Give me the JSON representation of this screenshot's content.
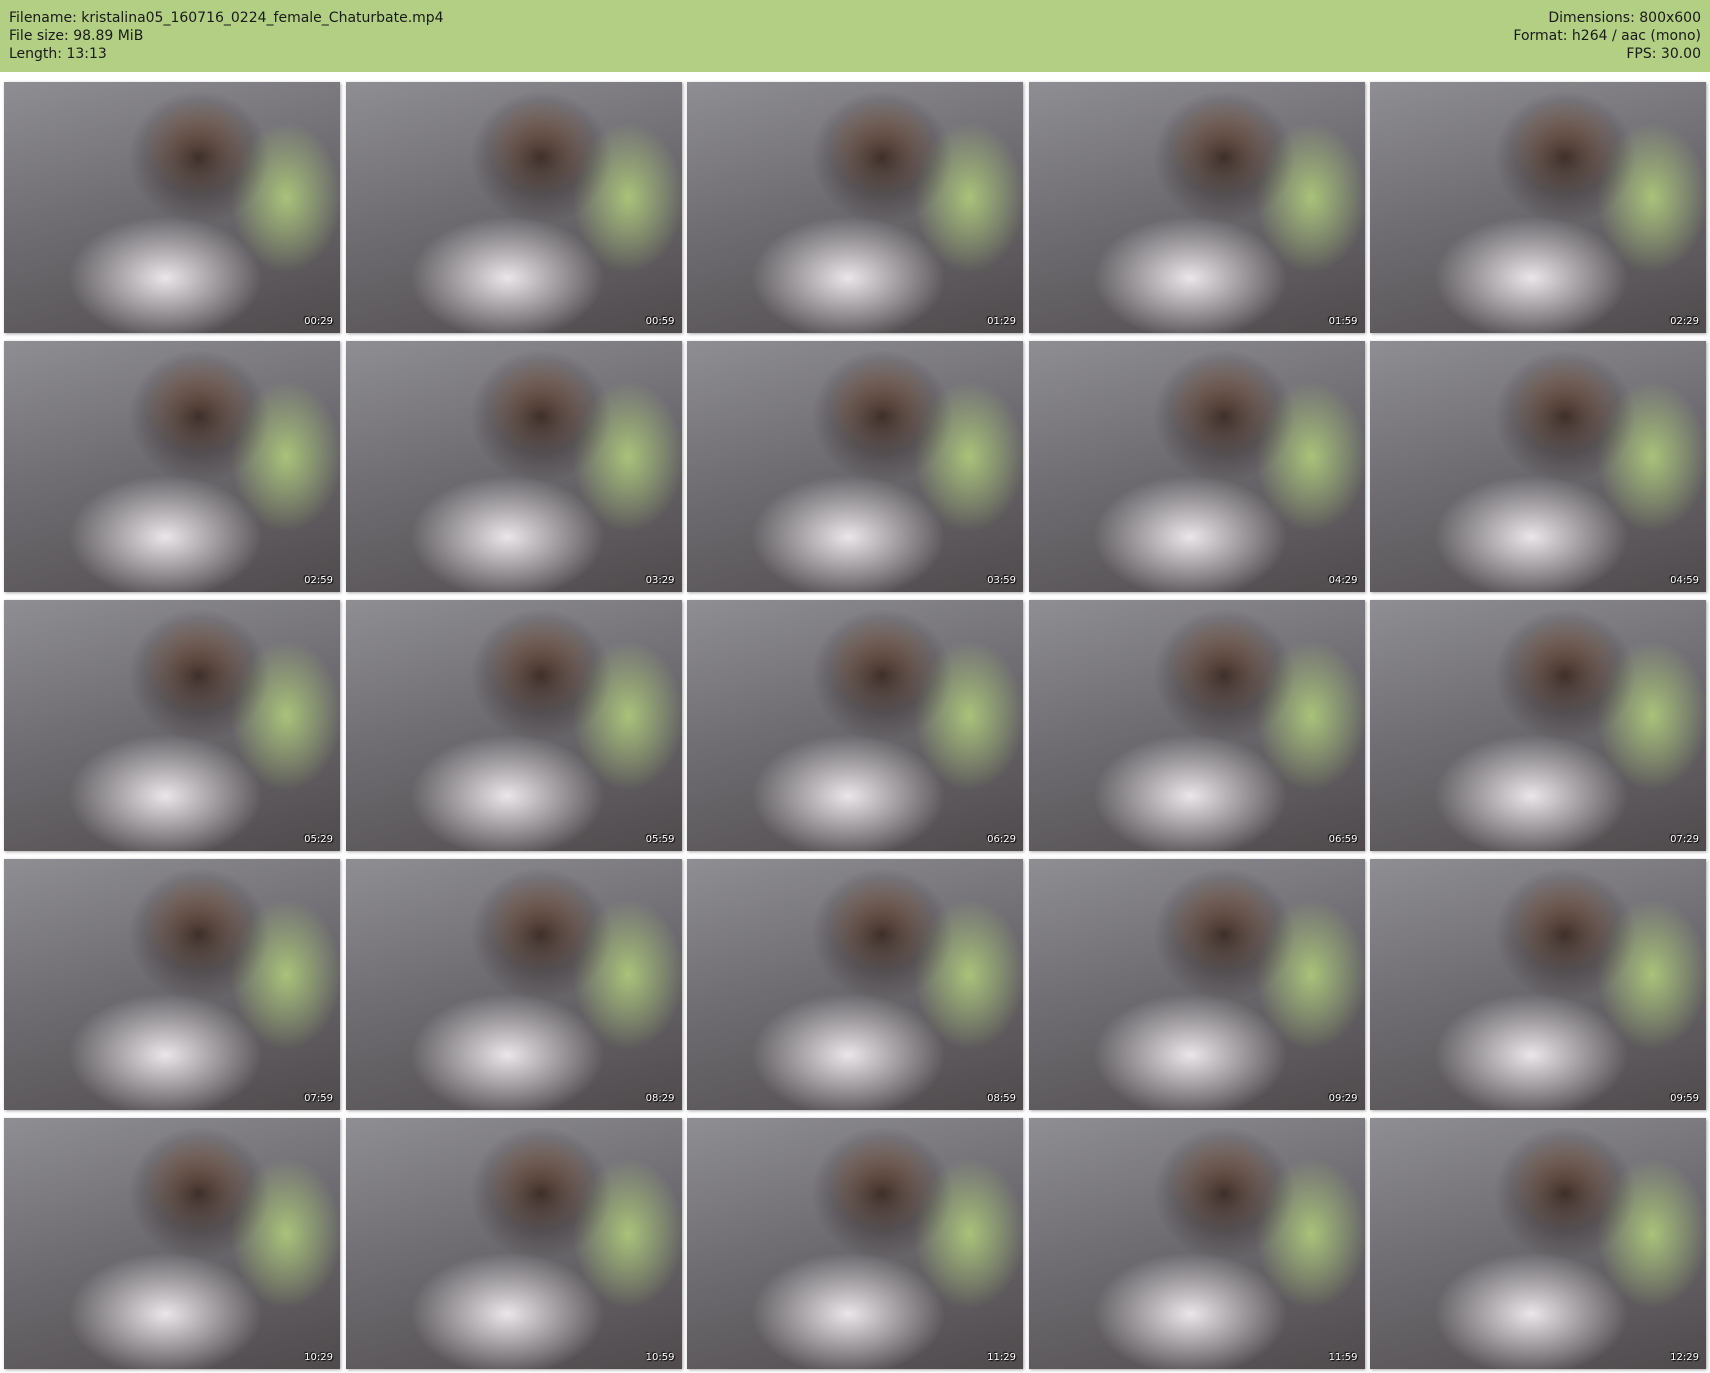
{
  "header": {
    "filename": "Filename: kristalina05_160716_0224_female_Chaturbate.mp4",
    "filesize": "File size: 98.89 MiB",
    "length": "Length: 13:13",
    "dimensions": "Dimensions: 800x600",
    "format": "Format: h264 / aac (mono)",
    "fps": "FPS: 30.00"
  },
  "colors": {
    "header_bg": "#b2cf83",
    "page_bg": "#ffffff"
  },
  "thumbnails": [
    {
      "time": "00:29"
    },
    {
      "time": "00:59"
    },
    {
      "time": "01:29"
    },
    {
      "time": "01:59"
    },
    {
      "time": "02:29"
    },
    {
      "time": "02:59"
    },
    {
      "time": "03:29"
    },
    {
      "time": "03:59"
    },
    {
      "time": "04:29"
    },
    {
      "time": "04:59"
    },
    {
      "time": "05:29"
    },
    {
      "time": "05:59"
    },
    {
      "time": "06:29"
    },
    {
      "time": "06:59"
    },
    {
      "time": "07:29"
    },
    {
      "time": "07:59"
    },
    {
      "time": "08:29"
    },
    {
      "time": "08:59"
    },
    {
      "time": "09:29"
    },
    {
      "time": "09:59"
    },
    {
      "time": "10:29"
    },
    {
      "time": "10:59"
    },
    {
      "time": "11:29"
    },
    {
      "time": "11:59"
    },
    {
      "time": "12:29"
    }
  ]
}
